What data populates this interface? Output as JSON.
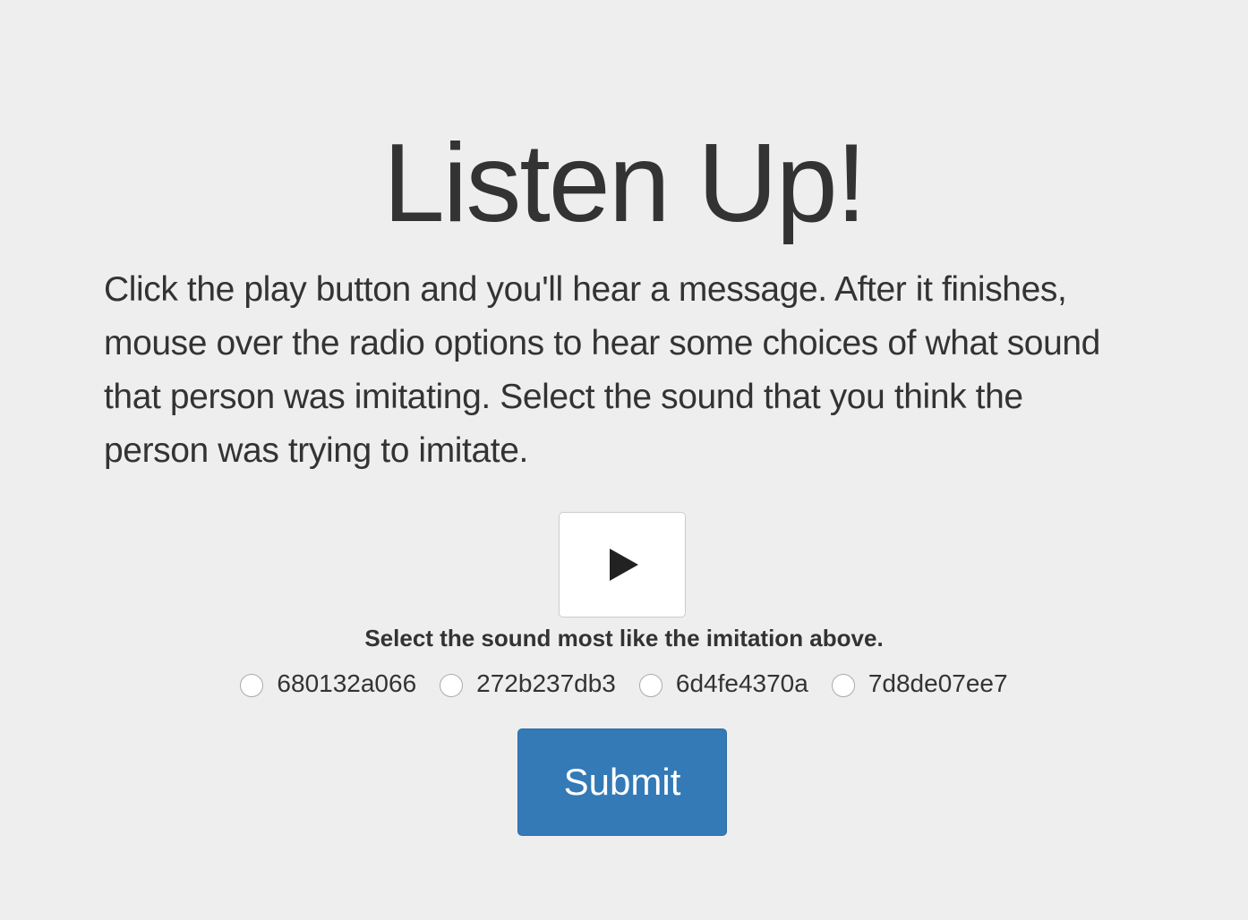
{
  "header": {
    "title": "Listen Up!"
  },
  "instructions": {
    "text": "Click the play button and you'll hear a message. After it finishes, mouse over the radio options to hear some choices of what sound that person was imitating. Select the sound that you think the person was trying to imitate."
  },
  "player": {
    "icon": "play-icon"
  },
  "question": {
    "prompt": "Select the sound most like the imitation above.",
    "options": [
      {
        "label": "680132a066",
        "selected": false
      },
      {
        "label": "272b237db3",
        "selected": false
      },
      {
        "label": "6d4fe4370a",
        "selected": false
      },
      {
        "label": "7d8de07ee7",
        "selected": false
      }
    ]
  },
  "actions": {
    "submit_label": "Submit"
  },
  "colors": {
    "background": "#eeeeee",
    "text": "#333333",
    "primary": "#337ab7"
  }
}
